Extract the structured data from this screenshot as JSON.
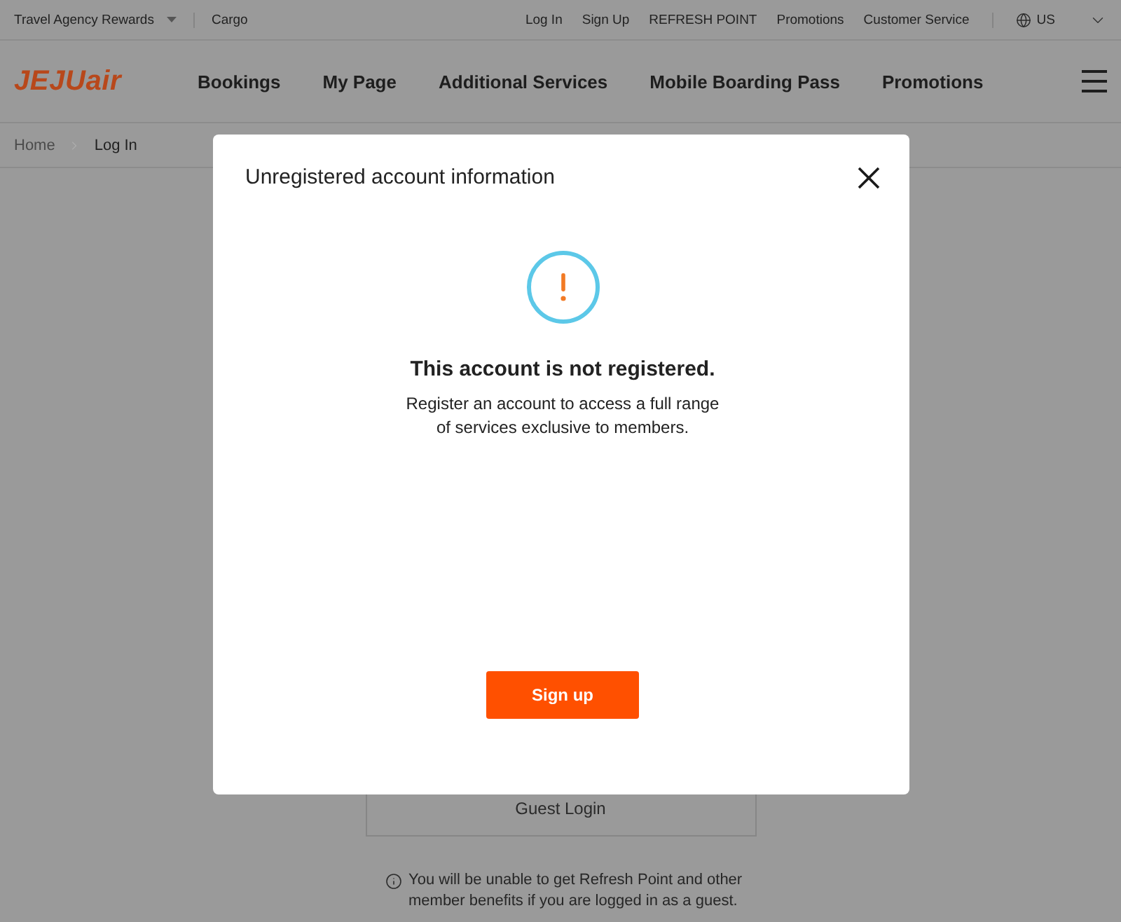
{
  "top_bar": {
    "left_links": [
      {
        "label": "Travel Agency Rewards",
        "kind": "dropdown"
      },
      {
        "label": "Cargo",
        "kind": "link"
      }
    ],
    "right_links": [
      "Log In",
      "Sign Up",
      "REFRESH POINT",
      "Promotions",
      "Customer Service"
    ],
    "language": "US"
  },
  "header": {
    "logo": "JEJUair",
    "nav": [
      "Bookings",
      "My Page",
      "Additional Services",
      "Mobile Boarding Pass",
      "Promotions"
    ]
  },
  "breadcrumb": [
    {
      "label": "Home",
      "current": false
    },
    {
      "label": "Log In",
      "current": true
    }
  ],
  "guest_login": {
    "button": "Guest Login",
    "notice": "You will be unable to get Refresh Point and other member benefits if you are logged in as a guest."
  },
  "dialog": {
    "title": "Unregistered account information",
    "heading": "This account is not registered.",
    "message": "Register an account to access a full range of services exclusive to members.",
    "button": "Sign up"
  }
}
